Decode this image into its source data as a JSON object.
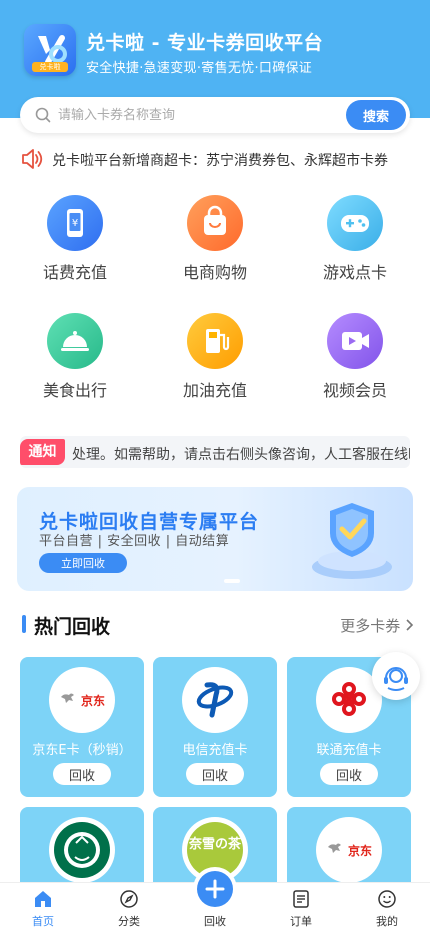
{
  "app": {
    "title": "兑卡啦 - 专业卡券回收平台",
    "subtitle": "安全快捷·急速变现·寄售无忧·口碑保证",
    "logo_badge": "兑卡啦"
  },
  "search": {
    "placeholder": "请输入卡券名称查询",
    "button": "搜索"
  },
  "notice": {
    "text": "兑卡啦平台新增商超卡：苏宁消费券包、永辉超市卡券"
  },
  "categories": [
    {
      "label": "话费充值",
      "icon": "phone-icon",
      "color": "#3b8cf4"
    },
    {
      "label": "电商购物",
      "icon": "shopping-bag-icon",
      "color": "#ff7a3d"
    },
    {
      "label": "游戏点卡",
      "icon": "gamepad-icon",
      "color": "#4fc1f0"
    },
    {
      "label": "美食出行",
      "icon": "food-cloche-icon",
      "color": "#34c79a"
    },
    {
      "label": "加油充值",
      "icon": "fuel-pump-icon",
      "color": "#ffb300"
    },
    {
      "label": "视频会员",
      "icon": "video-icon",
      "color": "#9b6bf2"
    }
  ],
  "notice2": {
    "tag": "通知",
    "text": "处理。如需帮助，请点击右侧头像咨询，人工客服在线时间"
  },
  "banner": {
    "title": "兑卡啦回收自营专属平台",
    "subtitle": "平台自营 | 安全回收 | 自动结算",
    "button": "立即回收"
  },
  "hot": {
    "title": "热门回收",
    "more": "更多卡券",
    "cards": [
      {
        "name": "京东E卡（秒销）",
        "button": "回收",
        "logo": "jd-logo"
      },
      {
        "name": "电信充值卡",
        "button": "回收",
        "logo": "china-telecom-logo"
      },
      {
        "name": "联通充值卡",
        "button": "回收",
        "logo": "china-unicom-logo"
      },
      {
        "name": "",
        "button": "",
        "logo": "starbucks-logo"
      },
      {
        "name": "",
        "button": "",
        "logo": "nayuki-logo",
        "logo_text": "奈雪の茶"
      },
      {
        "name": "",
        "button": "",
        "logo": "jd-logo"
      }
    ],
    "jd_logo_text": "京东"
  },
  "tabbar": {
    "items": [
      {
        "label": "首页",
        "icon": "home-icon",
        "active": true
      },
      {
        "label": "分类",
        "icon": "compass-icon",
        "active": false
      },
      {
        "label": "回收",
        "icon": "plus-icon",
        "active": false
      },
      {
        "label": "订单",
        "icon": "order-list-icon",
        "active": false
      },
      {
        "label": "我的",
        "icon": "smile-icon",
        "active": false
      }
    ]
  },
  "colors": {
    "primary": "#3b8cf4",
    "header": "#4fb3f3",
    "card": "#7dd3f7",
    "tag": "#ff4e6a"
  }
}
